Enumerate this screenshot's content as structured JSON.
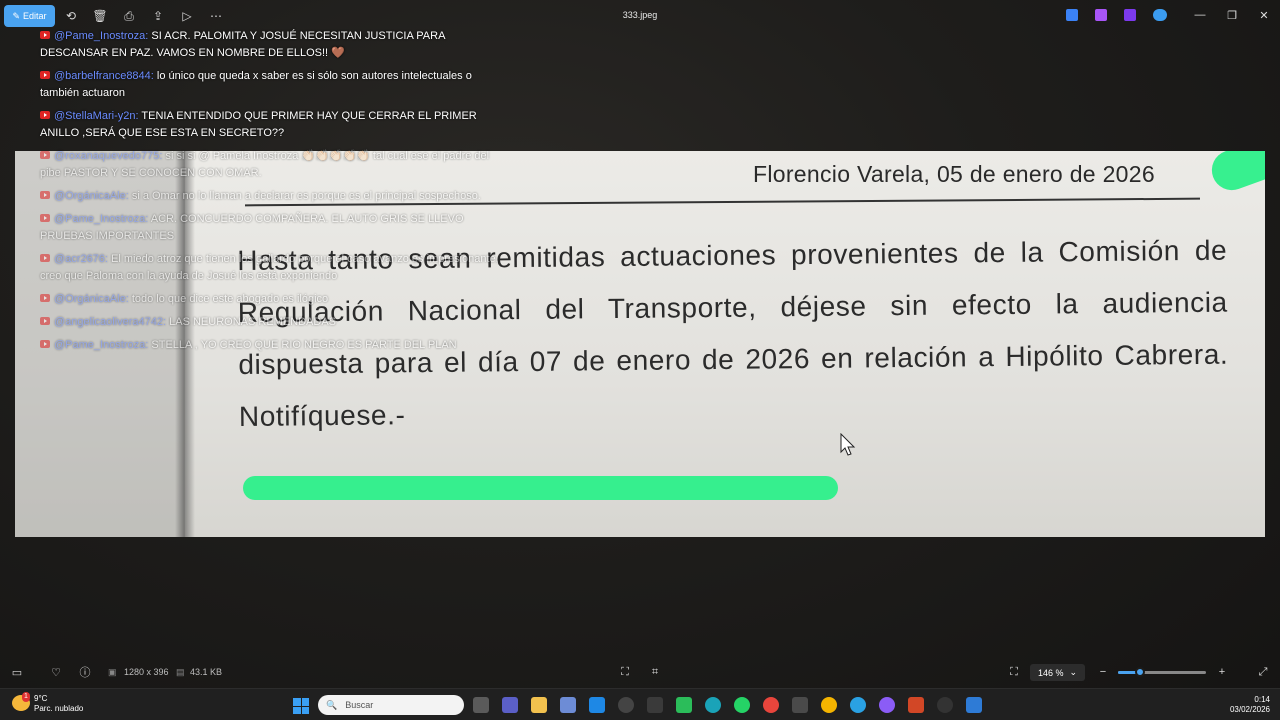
{
  "toolbar": {
    "edit_label": "Editar",
    "title": "333.jpeg"
  },
  "chat": [
    {
      "user": "@Pame_Inostroza:",
      "text": "SI ACR. PALOMITA Y JOSUÉ NECESITAN JUSTICIA PARA DESCANSAR EN PAZ. VAMOS EN NOMBRE DE ELLOS!! 🤎"
    },
    {
      "user": "@barbelfrance8844:",
      "text": "lo único que queda x saber es si sólo son autores intelectuales o también actuaron"
    },
    {
      "user": "@StellaMari-y2n:",
      "text": "TENIA ENTENDIDO QUE PRIMER HAY QUE CERRAR EL PRIMER ANILLO ,SERÁ QUE ESE ESTA EN SECRETO??"
    },
    {
      "user": "@roxanaquevedo775:",
      "text": "si si si @ Pamela Inostroza 👏🏻👏🏻👏🏻👏🏻👏🏻 tal cual ese el padre del pibe PASTOR Y SE CONOCEN CON OMAR."
    },
    {
      "user": "@OrgánicaAle:",
      "text": "si a Omar no lo llaman a declarar es porque es el principal sospechoso."
    },
    {
      "user": "@Pame_Inostroza:",
      "text": "ACR. CONCUERDO COMPAÑERA. EL AUTO GRIS SE LLEVO PRUEBAS IMPORTANTES"
    },
    {
      "user": "@acr2676:",
      "text": "El miedo atroz que tienen los gallardo porque el caso avanzo es impresionante, creo que Paloma con la ayuda de Josué los está exponiendo"
    },
    {
      "user": "@OrgánicaAle:",
      "text": "todo lo que dice este abogado es ilógico"
    },
    {
      "user": "@angelicaolivera4742:",
      "text": "LAS NEURONAS REMENDADAS"
    },
    {
      "user": "@Pame_Inostroza:",
      "text": "STELLA , YO CREO QUE RIO NEGRO ES PARTE DEL PLAN"
    }
  ],
  "document": {
    "date_line": "Florencio Varela, 05 de enero de 2026",
    "body": "Hasta tanto sean remitidas actuaciones provenientes de la Comisión de Regulación Nacional del Transporte, déjese sin efecto la audiencia dispuesta para el día 07 de enero de 2026 en relación a Hipólito Cabrera. Notifíquese.-"
  },
  "status": {
    "dimensions": "1280 x 396",
    "filesize": "43.1 KB",
    "zoom": "146 %",
    "zoom_fraction": 0.25
  },
  "taskbar": {
    "temp": "9°C",
    "weather": "Parc. nublado",
    "search_placeholder": "Buscar",
    "time": "0:14",
    "date": "03/02/2026",
    "weather_badge": "1"
  },
  "colors": {
    "accent": "#4aa3f0",
    "highlight": "#2df08a",
    "username": "#6b8cff"
  }
}
